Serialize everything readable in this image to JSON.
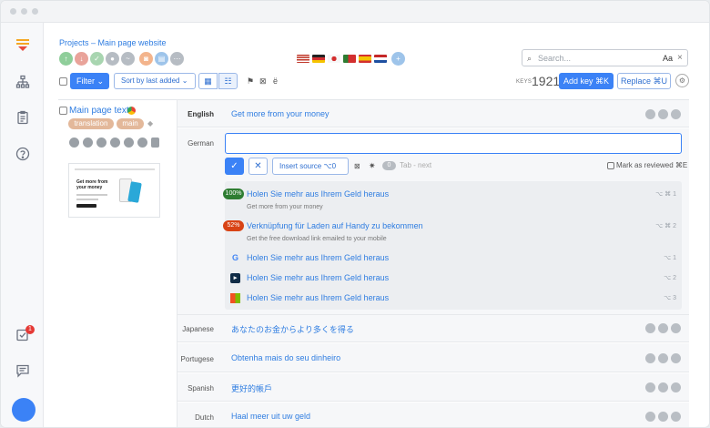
{
  "project": {
    "breadcrumb": "Projects – Main page website"
  },
  "search": {
    "placeholder": "Search...",
    "case_label": "Aa",
    "clear": "×"
  },
  "toolbar": {
    "filter_label": "Filter ⌄",
    "sort_label": "Sort by last added ⌄",
    "keys_label": "KEYS",
    "keys_count": "1921",
    "add_key_label": "Add key ⌘K",
    "replace_label": "Replace ⌘U"
  },
  "key": {
    "name": "Main page text",
    "tags": [
      "translation",
      "main"
    ],
    "thumbnail": {
      "headline": "Get more from your money"
    }
  },
  "rows": {
    "english": {
      "language": "English",
      "text": "Get more from your money"
    },
    "german": {
      "language": "German"
    },
    "japanese": {
      "language": "Japanese",
      "text": "あなたのお金からより多くを得る"
    },
    "portuguese": {
      "language": "Portugese",
      "text": "Obtenha mais do seu dinheiro"
    },
    "spanish": {
      "language": "Spanish",
      "text": "更好的帳戶"
    },
    "dutch": {
      "language": "Dutch",
      "text": "Haal meer uit uw geld"
    }
  },
  "editor": {
    "insert_source_label": "Insert source ⌥0",
    "tab_label": "0",
    "tab_next": "Tab - next",
    "mark_reviewed": "Mark as reviewed ⌘E"
  },
  "suggestions": [
    {
      "match": "100%",
      "text": "Holen Sie mehr aus Ihrem Geld heraus",
      "source": "Get more from your money",
      "shortcut": "⌥ ⌘ 1",
      "color": "#2e7d32"
    },
    {
      "match": "52%",
      "text": "Verknüpfung für Laden auf Handy zu bekommen",
      "source": "Get the free download link emailed to your mobile",
      "shortcut": "⌥ ⌘ 2",
      "color": "#d84315"
    }
  ],
  "machine_translations": [
    {
      "engine": "google-icon",
      "text": "Holen Sie mehr aus Ihrem Geld heraus",
      "shortcut": "⌥ 1"
    },
    {
      "engine": "deepl-icon",
      "text": "Holen Sie mehr aus Ihrem Geld heraus",
      "shortcut": "⌥ 2"
    },
    {
      "engine": "microsoft-icon",
      "text": "Holen Sie mehr aus Ihrem Geld heraus",
      "shortcut": "⌥ 3"
    }
  ],
  "notifications": {
    "count": "1"
  }
}
